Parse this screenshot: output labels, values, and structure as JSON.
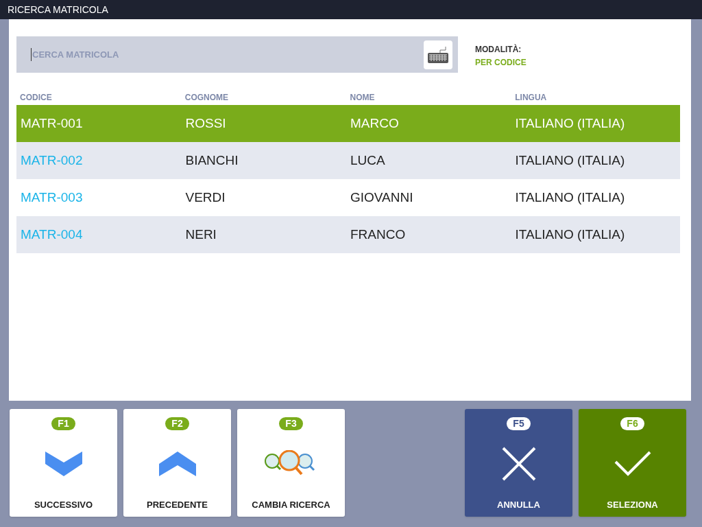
{
  "window": {
    "title": "RICERCA MATRICOLA"
  },
  "search": {
    "placeholder": "CERCA MATRICOLA"
  },
  "mode": {
    "label": "MODALITÀ:",
    "value": "PER CODICE"
  },
  "table": {
    "columns": [
      "CODICE",
      "COGNOME",
      "NOME",
      "LINGUA"
    ],
    "rows": [
      {
        "selected": true,
        "cells": [
          "MATR-001",
          "ROSSI",
          "MARCO",
          "ITALIANO (ITALIA)"
        ]
      },
      {
        "selected": false,
        "cells": [
          "MATR-002",
          "BIANCHI",
          "LUCA",
          "ITALIANO (ITALIA)"
        ]
      },
      {
        "selected": false,
        "cells": [
          "MATR-003",
          "VERDI",
          "GIOVANNI",
          "ITALIANO (ITALIA)"
        ]
      },
      {
        "selected": false,
        "cells": [
          "MATR-004",
          "NERI",
          "FRANCO",
          "ITALIANO (ITALIA)"
        ]
      }
    ]
  },
  "left_buttons": [
    {
      "key": "F1",
      "label": "SUCCESSIVO",
      "kind": "next"
    },
    {
      "key": "F2",
      "label": "PRECEDENTE",
      "kind": "previous"
    },
    {
      "key": "F3",
      "label": "CAMBIA RICERCA",
      "kind": "switch"
    }
  ],
  "right_buttons": [
    {
      "key": "F5",
      "label": "ANNULLA",
      "kind": "cancel"
    },
    {
      "key": "F6",
      "label": "SELEZIONA",
      "kind": "confirm"
    }
  ]
}
